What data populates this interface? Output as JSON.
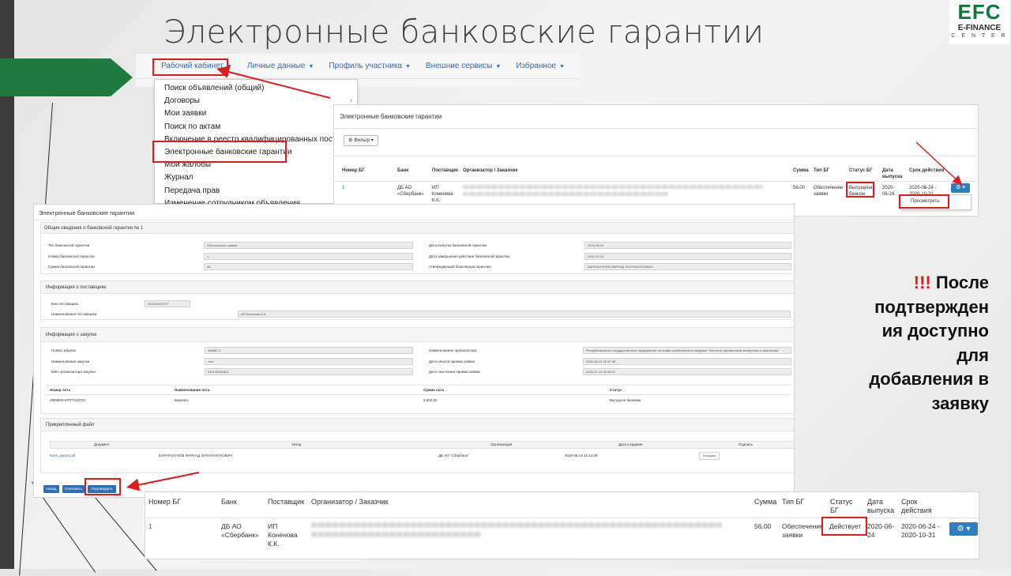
{
  "slide": {
    "title": "Электронные банковские гарантии",
    "logo": {
      "big": "EFC",
      "mid": "E-FINANCE",
      "small": "C E N T E R"
    },
    "note": {
      "exclamation": "!!!",
      "lines": [
        "После",
        "подтвержден",
        "ия доступно",
        "для",
        "добавления в",
        "заявку"
      ]
    }
  },
  "colors": {
    "accent_red": "#e01b1b",
    "link_blue": "#2a6ebb",
    "button_blue": "#2f7fc0",
    "logo_green": "#0b7a3a",
    "arrow_green": "#1e7a3e"
  },
  "nav": {
    "items": [
      "Рабочий кабинет",
      "Личные данные",
      "Профиль участника",
      "Внешние сервисы",
      "Избранное"
    ],
    "dropdown": [
      "Поиск объявлений (общий)",
      "Договоры",
      "Мои заявки",
      "Поиск по актам",
      "Включение в реестр квалифицированных поставщ",
      "Электронные банковские гарантии",
      "Мои жалобы",
      "Журнал",
      "Передача прав",
      "Изменение сотрудником объявления"
    ],
    "submenu_caret": "›"
  },
  "list": {
    "title": "Электронные банковские гарантии",
    "filter": "⚙ Фильтр ▾",
    "headers": [
      "Номер БГ",
      "Банк",
      "Поставщик",
      "Организатор / Заказчик",
      "Сумма",
      "Тип БГ",
      "Статус БГ",
      "Дата выпуска",
      "Срок действия"
    ],
    "row": {
      "number": "1",
      "bank": "ДБ АО «Сбербанк»",
      "supplier": "ИП Коненова К.К.",
      "sum": "56.00",
      "type": "Обеспечение заявки",
      "status": "Выпущена банком",
      "date": "2020-06-24",
      "term": "2020-06-24 - 2020-10-31"
    },
    "view_option": "Просмотреть",
    "action_icon": "gear-icon"
  },
  "detail": {
    "title": "Электронные банковские гарантии",
    "general": {
      "head": "Общие сведения о банковской гарантии № 1",
      "left": [
        {
          "label": "Тип банковской гарантии",
          "value": "Обеспечение заявки"
        },
        {
          "label": "Номер банковской гарантии",
          "value": "1"
        },
        {
          "label": "Сумма банковской гарантии",
          "value": "56"
        }
      ],
      "right": [
        {
          "label": "Дата выпуска банковской гарантии",
          "value": "2020-06-24"
        },
        {
          "label": "Дата завершения действия банковской гарантии",
          "value": "2020-10-31"
        },
        {
          "label": "Утверждающий банковскую гарантию",
          "value": "БАРАТАХУНОВ ФАРХАД ЗУНУНАХУНОВИЧ"
        }
      ]
    },
    "supplier": {
      "head": "Информация о поставщике",
      "fields": [
        {
          "label": "Бин поставщика",
          "value": "921226400767"
        },
        {
          "label": "Наименование поставщика",
          "value": "ИП Коненова К.К."
        }
      ]
    },
    "purchase": {
      "head": "Информация о закупке",
      "left": [
        {
          "label": "Номер закупки",
          "value": "486687-1"
        },
        {
          "label": "Наименование закупки",
          "value": "тест"
        },
        {
          "label": "БИН организатора закупки",
          "value": "040740001824"
        }
      ],
      "right": [
        {
          "label": "Наименование организатора",
          "value": "Республиканское государственное предприятие на праве хозяйственного ведения \"Институт финансовой экспертизы и аналитики\""
        },
        {
          "label": "Дата начала приема заявки",
          "value": "2020-06-24 09:37:08"
        },
        {
          "label": "Дата окончания приема заявки",
          "value": "2020-07-13 09:36:01"
        }
      ],
      "lot_headers": [
        "Номер лота",
        "Наименование лота",
        "Сумма лота",
        "Статус"
      ],
      "lot_row": [
        "4806809-КПТТ22/ЛО1",
        "Березка",
        "5 600,00",
        "Выгодное банками"
      ]
    },
    "files": {
      "head": "Прикрепленный файл",
      "headers": [
        "Документ",
        "Автор",
        "Организация",
        "Дата создания",
        "Подпись"
      ],
      "row": {
        "document": "bank_garant.pdf",
        "author": "БАРАТАХУНОВ ФАРХАД ЗУНУНАХУНОВИЧ",
        "org": "ДБ АО \"Сбербанк\"",
        "created": "2020-06-24 11:54:39",
        "sign": "Показать"
      }
    },
    "buttons": [
      "Назад",
      "Отклонить",
      "Подтвердить"
    ]
  },
  "bottom": {
    "headers": [
      "Номер БГ",
      "Банк",
      "Поставщик",
      "Организатор / Заказчик",
      "Сумма",
      "Тип БГ",
      "Статус БГ",
      "Дата выпуска",
      "Срок действия"
    ],
    "row": {
      "number": "1",
      "bank": "ДБ АО «Сбербанк»",
      "supplier": "ИП Коненова К.К.",
      "sum": "56.00",
      "type": "Обеспечение заявки",
      "status": "Действует",
      "date": "2020-06-24",
      "term": "2020-06-24 - 2020-10-31"
    }
  }
}
